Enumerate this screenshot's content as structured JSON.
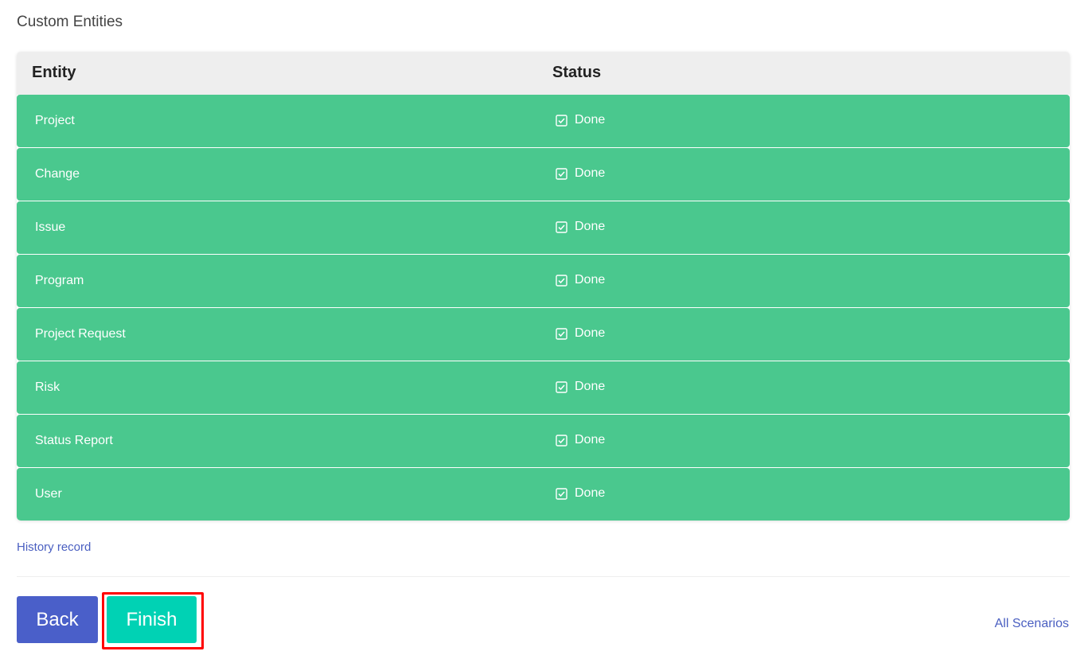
{
  "section": {
    "title": "Custom Entities"
  },
  "table": {
    "headers": {
      "entity": "Entity",
      "status": "Status"
    },
    "rows": [
      {
        "entity": "Project",
        "status": "Done"
      },
      {
        "entity": "Change",
        "status": "Done"
      },
      {
        "entity": "Issue",
        "status": "Done"
      },
      {
        "entity": "Program",
        "status": "Done"
      },
      {
        "entity": "Project Request",
        "status": "Done"
      },
      {
        "entity": "Risk",
        "status": "Done"
      },
      {
        "entity": "Status Report",
        "status": "Done"
      },
      {
        "entity": "User",
        "status": "Done"
      }
    ],
    "row_color": "#4ac88e",
    "status_icon": "checkbox-checked-icon"
  },
  "links": {
    "history": "History record",
    "all_scenarios": "All Scenarios"
  },
  "buttons": {
    "back": "Back",
    "finish": "Finish",
    "back_color": "#4a5fc9",
    "finish_color": "#00d2b4"
  }
}
